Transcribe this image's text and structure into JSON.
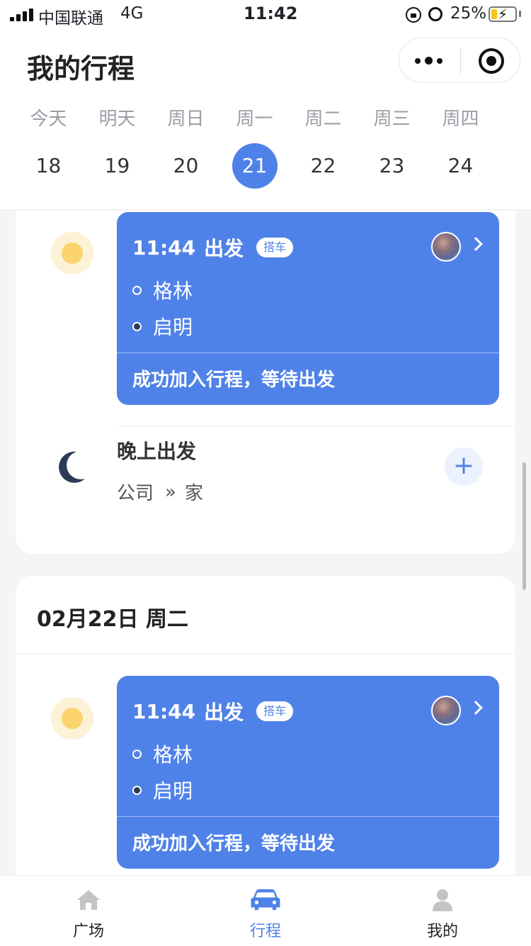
{
  "status_bar": {
    "carrier": "中国联通",
    "network": "4G",
    "time": "11:42",
    "battery": "25%"
  },
  "header": {
    "title": "我的行程",
    "days": [
      {
        "label": "今天",
        "num": "18"
      },
      {
        "label": "明天",
        "num": "19"
      },
      {
        "label": "周日",
        "num": "20"
      },
      {
        "label": "周一",
        "num": "21"
      },
      {
        "label": "周二",
        "num": "22"
      },
      {
        "label": "周三",
        "num": "23"
      },
      {
        "label": "周四",
        "num": "24"
      }
    ],
    "selected_day": "21"
  },
  "card1": {
    "trip": {
      "time": "11:44",
      "depart": "出发",
      "tag": "搭车",
      "from": "格林",
      "to": "启明",
      "status": "成功加入行程，等待出发"
    },
    "plan": {
      "title": "晚上出发",
      "from": "公司",
      "arrow": "»",
      "to": "家",
      "add": "+"
    }
  },
  "card2": {
    "date": "02月22日 周二",
    "trip": {
      "time": "11:44",
      "depart": "出发",
      "tag": "搭车",
      "from": "格林",
      "to": "启明",
      "status": "成功加入行程，等待出发"
    }
  },
  "tabbar": {
    "tabs": [
      {
        "label": "广场",
        "icon": "home-icon"
      },
      {
        "label": "行程",
        "icon": "car-icon"
      },
      {
        "label": "我的",
        "icon": "user-icon"
      }
    ],
    "active": "行程"
  },
  "colors": {
    "accent": "#4f82e8",
    "sun": "#fbd46f",
    "moon": "#2b3a55"
  }
}
